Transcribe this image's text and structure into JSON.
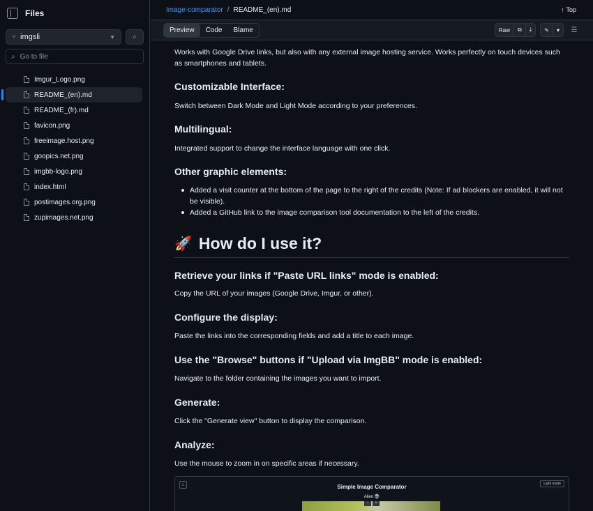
{
  "sidebar": {
    "title": "Files",
    "branch": "imgsli",
    "goto_placeholder": "Go to file",
    "files": [
      {
        "name": "Imgur_Logo.png",
        "active": false
      },
      {
        "name": "README_(en).md",
        "active": true
      },
      {
        "name": "README_(fr).md",
        "active": false
      },
      {
        "name": "favicon.png",
        "active": false
      },
      {
        "name": "freeimage.host.png",
        "active": false
      },
      {
        "name": "goopics.net.png",
        "active": false
      },
      {
        "name": "imgbb-logo.png",
        "active": false
      },
      {
        "name": "index.html",
        "active": false
      },
      {
        "name": "postimages.org.png",
        "active": false
      },
      {
        "name": "zupimages.net.png",
        "active": false
      }
    ]
  },
  "header": {
    "repo": "Image-comparator",
    "separator": "/",
    "file": "README_(en).md",
    "top_label": "Top"
  },
  "toolbar": {
    "tabs": [
      "Preview",
      "Code",
      "Blame"
    ],
    "raw_label": "Raw"
  },
  "content": {
    "intro": "Works with Google Drive links, but also with any external image hosting service. Works perfectly on touch devices such as smartphones and tablets.",
    "h_interface": "Customizable Interface:",
    "p_interface": "Switch between Dark Mode and Light Mode according to your preferences.",
    "h_multi": "Multilingual:",
    "p_multi": "Integrated support to change the interface language with one click.",
    "h_other": "Other graphic elements:",
    "bullets": [
      "Added a visit counter at the bottom of the page to the right of the credits (Note: If ad blockers are enabled, it will not be visible).",
      "Added a GitHub link to the image comparison tool documentation to the left of the credits."
    ],
    "h2": "How do I use it?",
    "h_retrieve": "Retrieve your links if \"Paste URL links\" mode is enabled:",
    "p_retrieve": "Copy the URL of your images (Google Drive, Imgur, or other).",
    "h_configure": "Configure the display:",
    "p_configure": "Paste the links into the corresponding fields and add a title to each image.",
    "h_browse": "Use the \"Browse\" buttons if \"Upload via ImgBB\" mode is enabled:",
    "p_browse": "Navigate to the folder containing the images you want to import.",
    "h_generate": "Generate:",
    "p_generate": "Click the \"Generate view\" button to display the comparison.",
    "h_analyze": "Analyze:",
    "p_analyze": "Use the mouse to zoom in on specific areas if necessary."
  },
  "preview": {
    "title": "Simple Image Comparator",
    "subtitle": "Alien 👽",
    "mode_button": "Light mode"
  }
}
